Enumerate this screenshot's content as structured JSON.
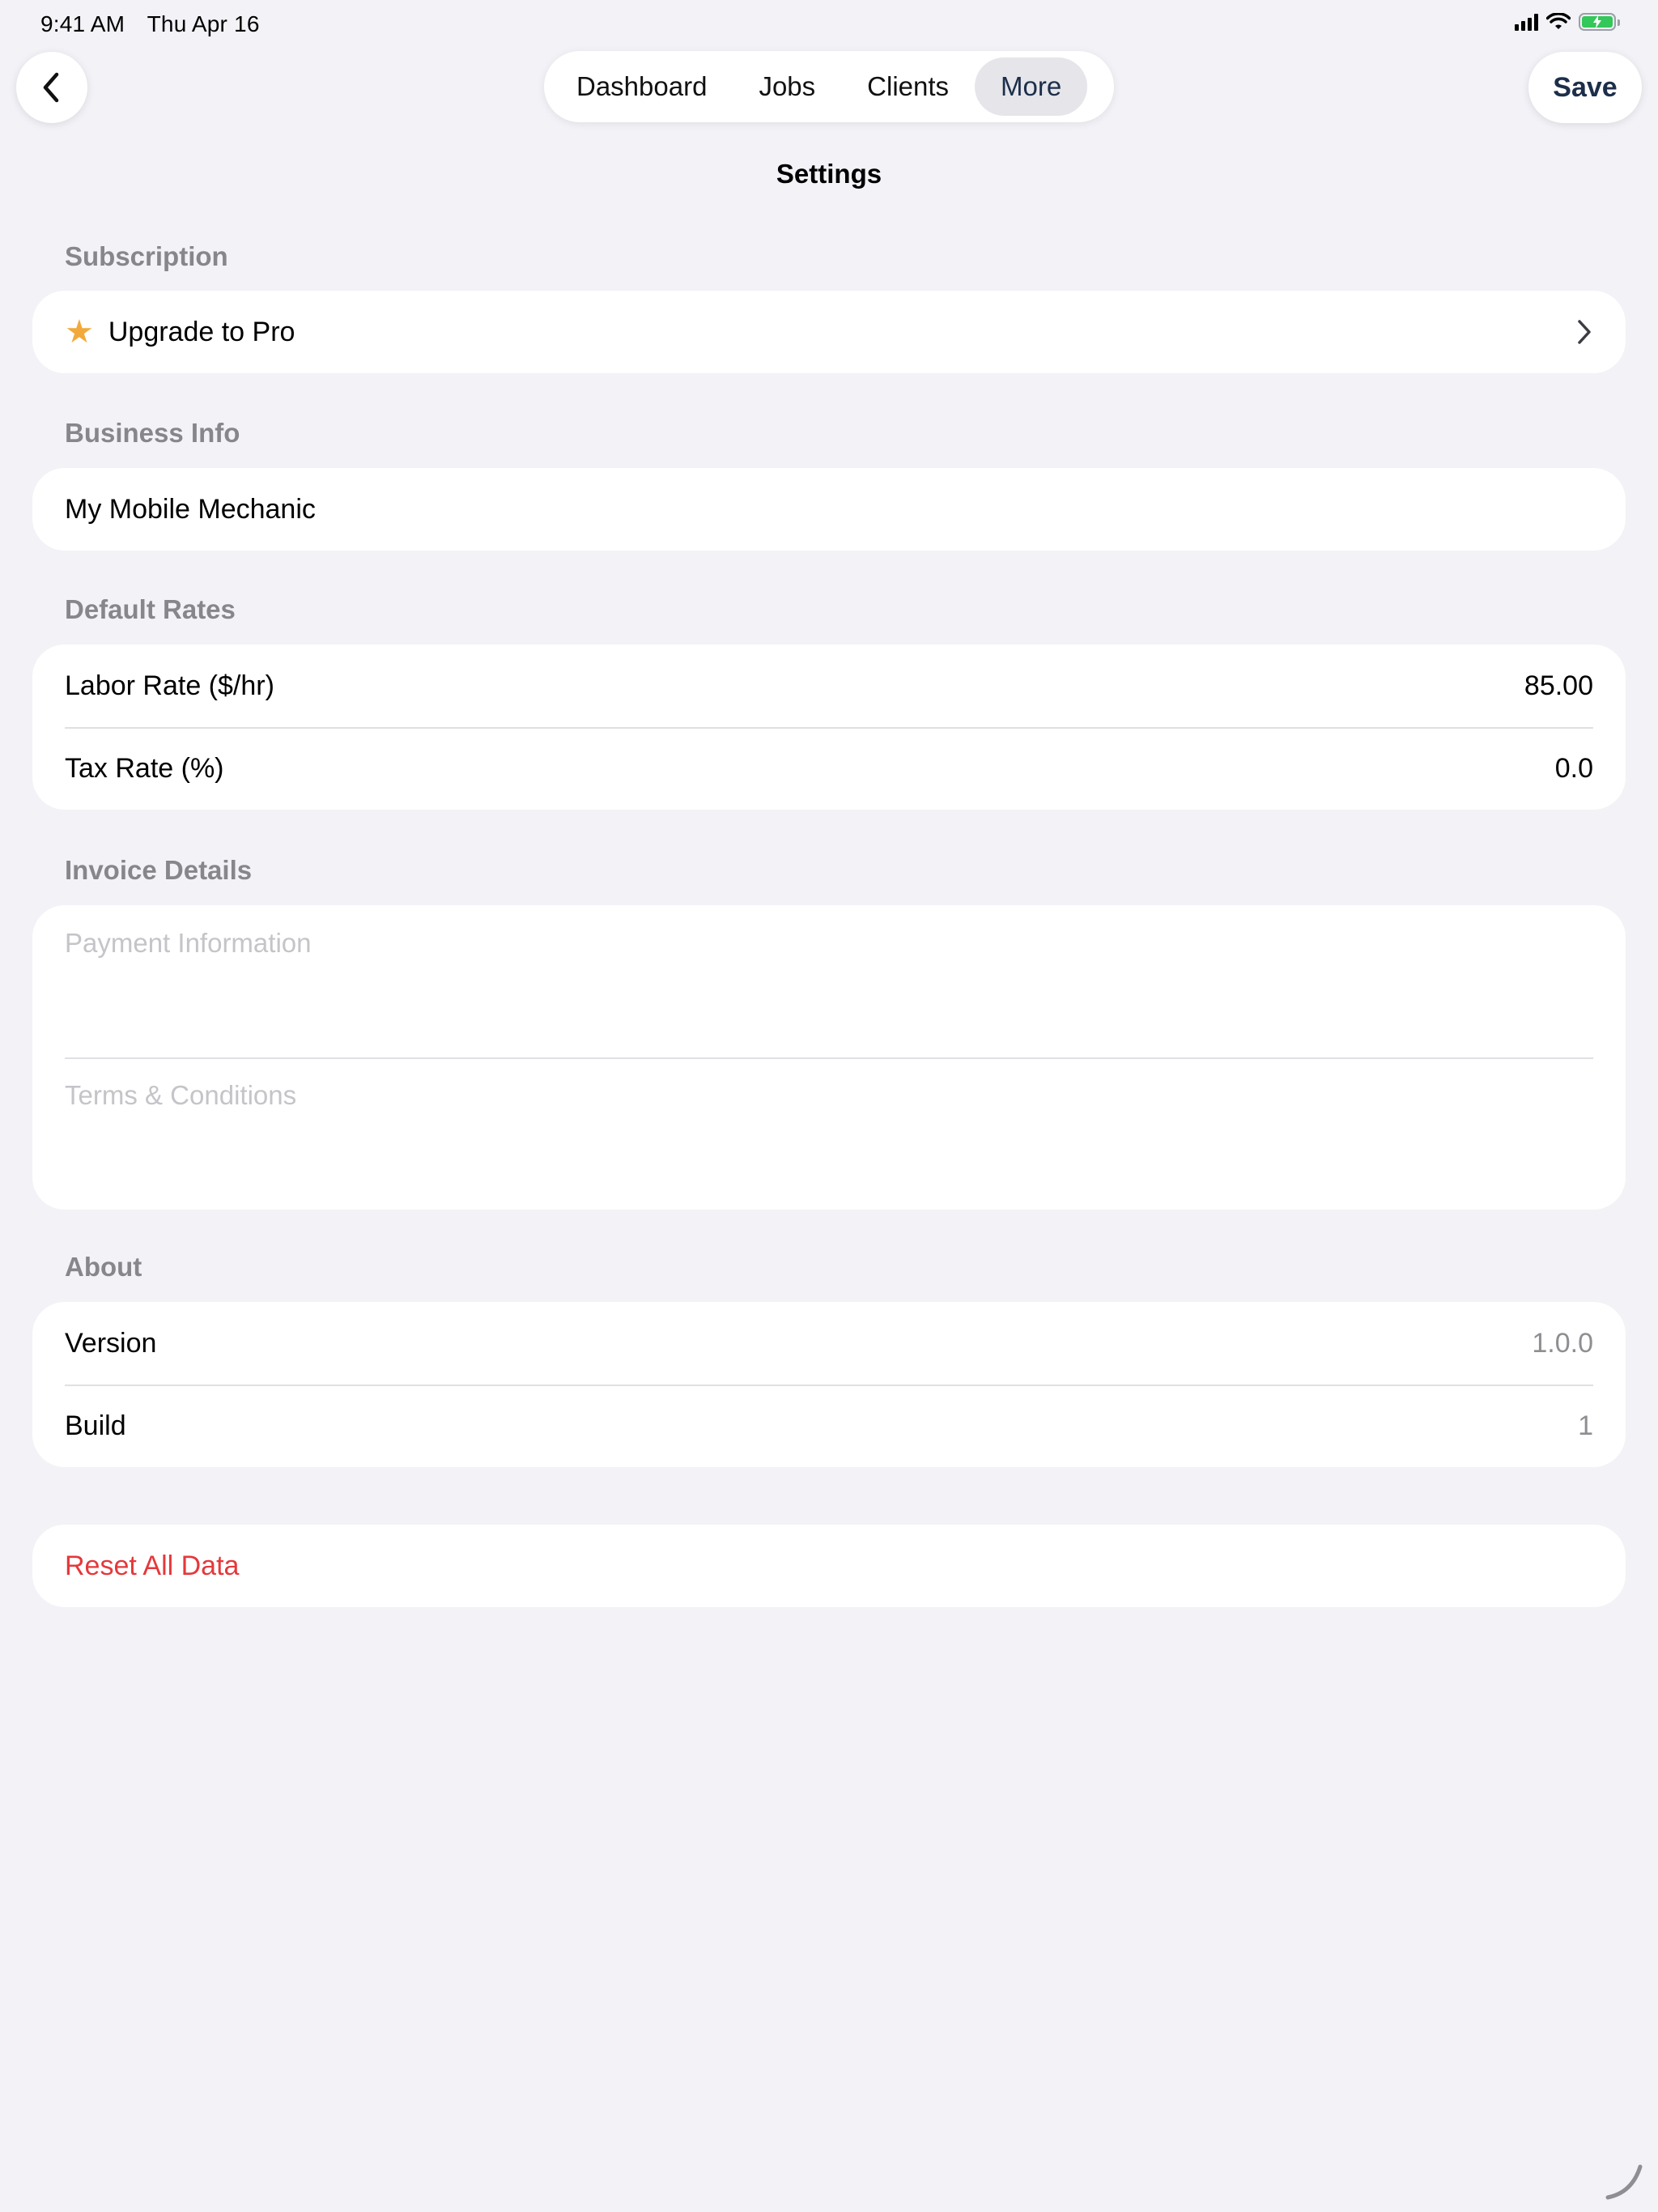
{
  "status": {
    "time": "9:41 AM",
    "date": "Thu Apr 16"
  },
  "nav": {
    "tabs": [
      {
        "label": "Dashboard"
      },
      {
        "label": "Jobs"
      },
      {
        "label": "Clients"
      },
      {
        "label": "More",
        "active": true
      }
    ],
    "save_label": "Save"
  },
  "page": {
    "title": "Settings"
  },
  "subscription": {
    "header": "Subscription",
    "upgrade_label": "Upgrade to Pro"
  },
  "business": {
    "header": "Business Info",
    "name": "My Mobile Mechanic"
  },
  "rates": {
    "header": "Default Rates",
    "labor_label": "Labor Rate ($/hr)",
    "labor_value": "85.00",
    "tax_label": "Tax Rate (%)",
    "tax_value": "0.0"
  },
  "invoice": {
    "header": "Invoice Details",
    "payment_placeholder": "Payment Information",
    "terms_placeholder": "Terms & Conditions"
  },
  "about": {
    "header": "About",
    "version_label": "Version",
    "version_value": "1.0.0",
    "build_label": "Build",
    "build_value": "1"
  },
  "danger": {
    "reset_label": "Reset All Data"
  },
  "colors": {
    "accent": "#1c2e4a",
    "danger": "#e5383b",
    "star": "#f2a93b",
    "background": "#f2f2f7"
  },
  "icons": [
    "chevron-left-icon",
    "star-icon",
    "chevron-right-icon",
    "wifi-icon",
    "battery-icon",
    "signal-icon"
  ]
}
